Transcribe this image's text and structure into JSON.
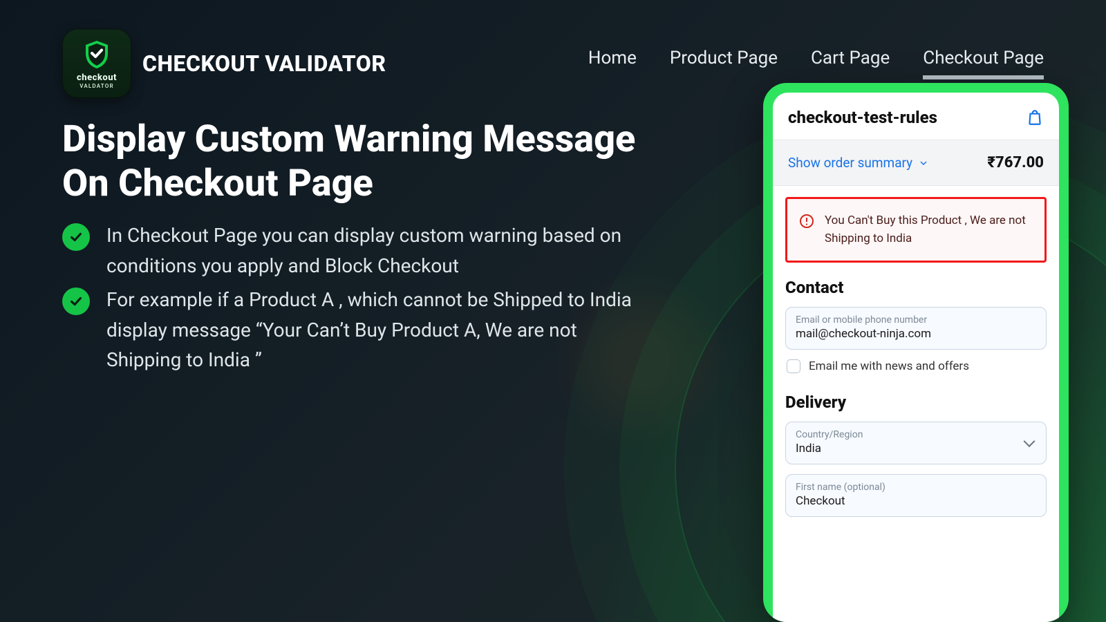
{
  "brand": {
    "title": "CHECKOUT VALIDATOR",
    "logo_word1": "checkout",
    "logo_word2": "VALDATOR"
  },
  "nav": {
    "home": "Home",
    "product": "Product Page",
    "cart": "Cart Page",
    "checkout": "Checkout Page"
  },
  "headline": "Display Custom Warning Message On Checkout  Page",
  "bullets": [
    "In Checkout Page you can display custom warning based on conditions you apply and Block Checkout",
    "For example if a Product A , which cannot be Shipped to India display message “Your Can’t Buy  Product A, We are not Shipping to India ”"
  ],
  "mock": {
    "store_name": "checkout-test-rules",
    "summary_label": "Show order summary",
    "price": "₹767.00",
    "alert": "You Can't Buy this Product , We are not Shipping to India",
    "contact_heading": "Contact",
    "email_label": "Email or mobile phone number",
    "email_value": "mail@checkout-ninja.com",
    "news_label": "Email me with news and offers",
    "delivery_heading": "Delivery",
    "country_label": "Country/Region",
    "country_value": "India",
    "firstname_label": "First name (optional)",
    "firstname_value": "Checkout"
  }
}
